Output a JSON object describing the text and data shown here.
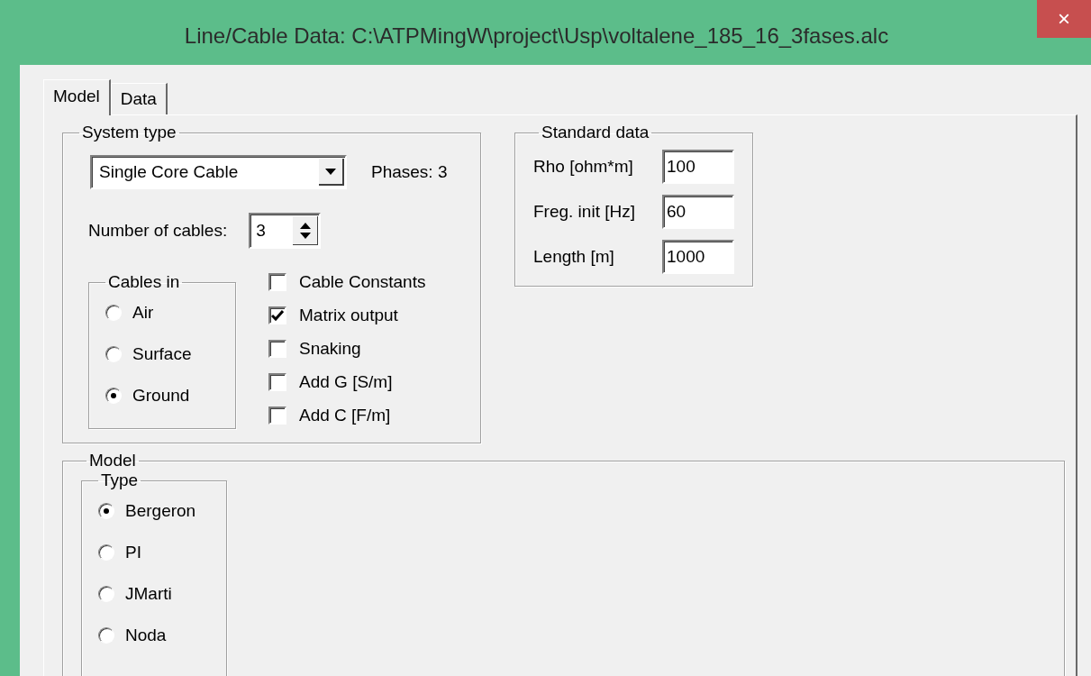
{
  "window": {
    "title": "Line/Cable Data: C:\\ATPMingW\\project\\Usp\\voltalene_185_16_3fases.alc",
    "close": "×"
  },
  "tabs": [
    {
      "label": "Model",
      "selected": true
    },
    {
      "label": "Data",
      "selected": false
    }
  ],
  "system_type": {
    "title": "System type",
    "dropdown": {
      "value": "Single Core Cable"
    },
    "phases": "Phases: 3",
    "cables_label": "Number of cables:",
    "cables_value": "3",
    "cables_in": {
      "title": "Cables in",
      "options": [
        {
          "label": "Air",
          "selected": false
        },
        {
          "label": "Surface",
          "selected": false
        },
        {
          "label": "Ground",
          "selected": true
        }
      ]
    },
    "checkboxes": [
      {
        "label": "Cable Constants",
        "checked": false
      },
      {
        "label": "Matrix output",
        "checked": true
      },
      {
        "label": "Snaking",
        "checked": false
      },
      {
        "label": "Add G [S/m]",
        "checked": false
      },
      {
        "label": "Add C [F/m]",
        "checked": false
      }
    ]
  },
  "standard_data": {
    "title": "Standard data",
    "fields": [
      {
        "label": "Rho [ohm*m]",
        "value": "100"
      },
      {
        "label": "Freg. init [Hz]",
        "value": "60"
      },
      {
        "label": "Length [m]",
        "value": "1000"
      }
    ]
  },
  "model": {
    "title": "Model",
    "type": {
      "title": "Type",
      "options": [
        {
          "label": "Bergeron",
          "selected": true
        },
        {
          "label": "PI",
          "selected": false
        },
        {
          "label": "JMarti",
          "selected": false
        },
        {
          "label": "Noda",
          "selected": false
        }
      ]
    }
  }
}
